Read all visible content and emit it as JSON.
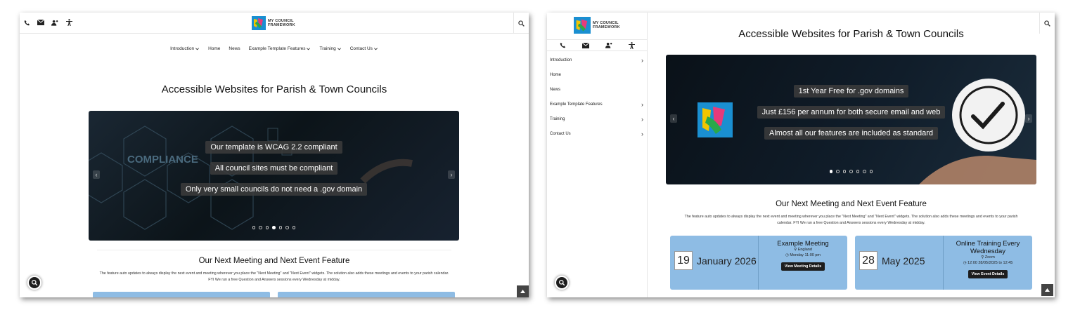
{
  "icons": {
    "phone": "phone-icon",
    "email": "email-icon",
    "people": "contact-person-icon",
    "accessibility": "accessibility-icon",
    "search": "search-icon"
  },
  "brand": {
    "line1": "MY COUNCIL",
    "line2": "FRAMEWORK"
  },
  "colors": {
    "card": "#8ebce4",
    "button": "#1d1d1d"
  },
  "desktop": {
    "nav": [
      {
        "label": "Introduction",
        "dropdown": true
      },
      {
        "label": "Home",
        "dropdown": false
      },
      {
        "label": "News",
        "dropdown": false
      },
      {
        "label": "Example Template Features",
        "dropdown": true
      },
      {
        "label": "Training",
        "dropdown": true
      },
      {
        "label": "Contact Us",
        "dropdown": true
      }
    ],
    "title": "Accessible Websites for Parish & Town Councils",
    "slide": {
      "lines": [
        "Our template is WCAG 2.2 compliant",
        "All council sites must be compliant",
        "Only very small councils do not need a .gov domain"
      ],
      "slide_count": 7,
      "active_slide": 4,
      "bg_word": "COMPLIANCE"
    },
    "section_title": "Our Next Meeting and Next Event Feature",
    "section_desc": "The feature auto updates to always display the next event and meeting wherever you place the \"Next Meeting\" and \"Next Event\" widgets. The solution also adds these meetings and events to your parish calendar. FYI We run a free Question and Answers sessions every Wednesday at midday."
  },
  "mobile": {
    "nav": [
      {
        "label": "Introduction",
        "has_sub": true
      },
      {
        "label": "Home",
        "has_sub": false
      },
      {
        "label": "News",
        "has_sub": false
      },
      {
        "label": "Example Template Features",
        "has_sub": true
      },
      {
        "label": "Training",
        "has_sub": true
      },
      {
        "label": "Contact Us",
        "has_sub": true
      }
    ],
    "title": "Accessible Websites for Parish & Town Councils",
    "slide": {
      "lines": [
        "1st Year Free for .gov domains",
        "Just £156 per annum for both secure email and web",
        "Almost all our features are included as standard"
      ],
      "slide_count": 7,
      "active_slide": 1
    },
    "section_title": "Our Next Meeting and Next Event Feature",
    "section_desc": "The feature auto updates to always display the next event and meeting wherever you place the \"Next Meeting\" and \"Next Event\" widgets. The solution also adds these meetings and events to your parish calendar. FYI We run a free Question and Answers sessions every Wednesday at midday.",
    "meeting": {
      "day": "19",
      "month_year": "January 2026",
      "name": "Example Meeting",
      "location": "England",
      "time": "Monday 11:00 pm",
      "button": "View Meeting Details"
    },
    "event": {
      "day": "28",
      "month_year": "May 2025",
      "name": "Online Training Every Wednesday",
      "location": "Zoom",
      "time": "12:00 28/05/2025 to 12:45",
      "button": "View Event Details"
    }
  }
}
